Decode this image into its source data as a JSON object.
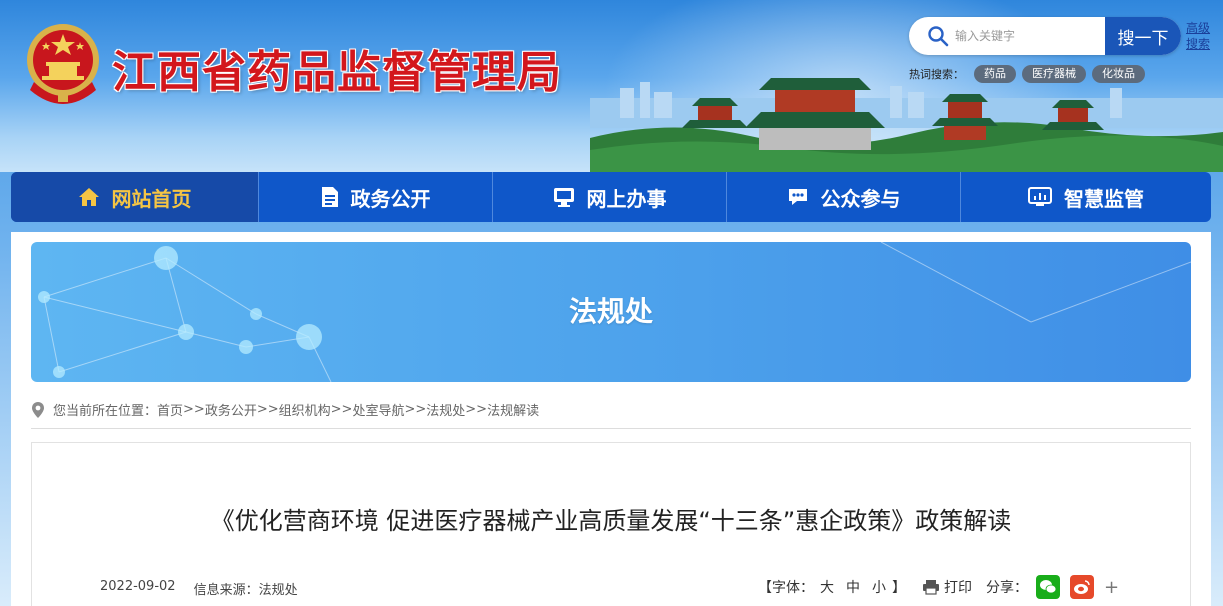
{
  "header": {
    "site_title": "江西省药品监督管理局",
    "search": {
      "placeholder": "输入关键字",
      "button_label": "搜一下",
      "advanced_label": "高级搜索"
    },
    "hot_search": {
      "label": "热词搜索：",
      "tags": [
        "药品",
        "医疗器械",
        "化妆品"
      ]
    }
  },
  "nav": {
    "items": [
      {
        "label": "网站首页",
        "icon": "home-icon"
      },
      {
        "label": "政务公开",
        "icon": "document-icon"
      },
      {
        "label": "网上办事",
        "icon": "monitor-icon"
      },
      {
        "label": "公众参与",
        "icon": "chat-icon"
      },
      {
        "label": "智慧监管",
        "icon": "dashboard-icon"
      }
    ]
  },
  "banner": {
    "title": "法规处"
  },
  "breadcrumb": {
    "prefix": "您当前所在位置：",
    "items": [
      "首页",
      "政务公开",
      "组织机构",
      "处室导航",
      "法规处",
      "法规解读"
    ],
    "separator": ">>"
  },
  "article": {
    "title": "《优化营商环境 促进医疗器械产业高质量发展“十三条”惠企政策》政策解读",
    "date": "2022-09-02",
    "source": "信息来源：法规处",
    "font_label_open": "【字体：",
    "font_large": "大",
    "font_medium": "中",
    "font_small": "小",
    "font_label_close": "】",
    "print_label": "打印",
    "share_label": "分享：",
    "more_label": "+"
  },
  "colors": {
    "nav_bg": "#0f57c9",
    "nav_active_text": "#f5c544",
    "title_red": "#d3171c",
    "search_button": "#1a56b8"
  }
}
